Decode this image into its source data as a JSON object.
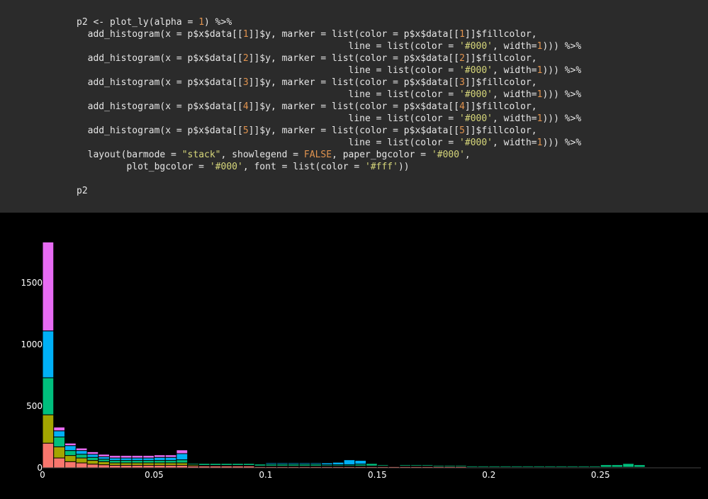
{
  "code": {
    "lines": [
      [
        {
          "t": "p2 <- plot_ly(alpha = "
        },
        {
          "t": "1",
          "c": "num"
        },
        {
          "t": ") %>%"
        }
      ],
      [
        {
          "t": "  add_histogram(x = p$x$data[["
        },
        {
          "t": "1",
          "c": "num"
        },
        {
          "t": "]]$y, marker = list(color = p$x$data[["
        },
        {
          "t": "1",
          "c": "num"
        },
        {
          "t": "]]$fillcolor,"
        }
      ],
      [
        {
          "t": "                                                 line = list(color = "
        },
        {
          "t": "'#000'",
          "c": "str"
        },
        {
          "t": ", width="
        },
        {
          "t": "1",
          "c": "num"
        },
        {
          "t": "))) %>%"
        }
      ],
      [
        {
          "t": "  add_histogram(x = p$x$data[["
        },
        {
          "t": "2",
          "c": "num"
        },
        {
          "t": "]]$y, marker = list(color = p$x$data[["
        },
        {
          "t": "2",
          "c": "num"
        },
        {
          "t": "]]$fillcolor,"
        }
      ],
      [
        {
          "t": "                                                 line = list(color = "
        },
        {
          "t": "'#000'",
          "c": "str"
        },
        {
          "t": ", width="
        },
        {
          "t": "1",
          "c": "num"
        },
        {
          "t": "))) %>%"
        }
      ],
      [
        {
          "t": "  add_histogram(x = p$x$data[["
        },
        {
          "t": "3",
          "c": "num"
        },
        {
          "t": "]]$y, marker = list(color = p$x$data[["
        },
        {
          "t": "3",
          "c": "num"
        },
        {
          "t": "]]$fillcolor,"
        }
      ],
      [
        {
          "t": "                                                 line = list(color = "
        },
        {
          "t": "'#000'",
          "c": "str"
        },
        {
          "t": ", width="
        },
        {
          "t": "1",
          "c": "num"
        },
        {
          "t": "))) %>%"
        }
      ],
      [
        {
          "t": "  add_histogram(x = p$x$data[["
        },
        {
          "t": "4",
          "c": "num"
        },
        {
          "t": "]]$y, marker = list(color = p$x$data[["
        },
        {
          "t": "4",
          "c": "num"
        },
        {
          "t": "]]$fillcolor,"
        }
      ],
      [
        {
          "t": "                                                 line = list(color = "
        },
        {
          "t": "'#000'",
          "c": "str"
        },
        {
          "t": ", width="
        },
        {
          "t": "1",
          "c": "num"
        },
        {
          "t": "))) %>%"
        }
      ],
      [
        {
          "t": "  add_histogram(x = p$x$data[["
        },
        {
          "t": "5",
          "c": "num"
        },
        {
          "t": "]]$y, marker = list(color = p$x$data[["
        },
        {
          "t": "5",
          "c": "num"
        },
        {
          "t": "]]$fillcolor,"
        }
      ],
      [
        {
          "t": "                                                 line = list(color = "
        },
        {
          "t": "'#000'",
          "c": "str"
        },
        {
          "t": ", width="
        },
        {
          "t": "1",
          "c": "num"
        },
        {
          "t": "))) %>%"
        }
      ],
      [
        {
          "t": "  layout(barmode = "
        },
        {
          "t": "\"stack\"",
          "c": "str"
        },
        {
          "t": ", showlegend = "
        },
        {
          "t": "FALSE",
          "c": "bool"
        },
        {
          "t": ", paper_bgcolor = "
        },
        {
          "t": "'#000'",
          "c": "str"
        },
        {
          "t": ","
        }
      ],
      [
        {
          "t": "         plot_bgcolor = "
        },
        {
          "t": "'#000'",
          "c": "str"
        },
        {
          "t": ", font = list(color = "
        },
        {
          "t": "'#fff'",
          "c": "str"
        },
        {
          "t": "))"
        }
      ],
      [
        {
          "t": ""
        }
      ],
      [
        {
          "t": "p2"
        }
      ]
    ]
  },
  "colors": {
    "code_bg": "#2b2b2b",
    "plot_bg": "#000000",
    "axis_text": "#ffffff",
    "bar_outline": "#000000"
  },
  "chart_data": {
    "type": "bar",
    "barmode": "stack",
    "showlegend": false,
    "grid": false,
    "bin_width": 0.005,
    "x_start": 0,
    "xlim": [
      0,
      0.295
    ],
    "ylim": [
      0,
      1850
    ],
    "x_ticks": [
      0,
      0.05,
      0.1,
      0.15,
      0.2,
      0.25
    ],
    "x_tick_labels": [
      "0",
      "0.05",
      "0.1",
      "0.15",
      "0.2",
      "0.25"
    ],
    "y_ticks": [
      0,
      500,
      1000,
      1500
    ],
    "y_tick_labels": [
      "0",
      "500",
      "1000",
      "1500"
    ],
    "series": [
      {
        "color": "#F8766D",
        "values": [
          200,
          80,
          50,
          40,
          30,
          25,
          20,
          20,
          20,
          20,
          20,
          20,
          20,
          15,
          15,
          15,
          15,
          15,
          15,
          10,
          10,
          10,
          10,
          10,
          10,
          10,
          10,
          10,
          10,
          10,
          10,
          10,
          10,
          10,
          10,
          10,
          10,
          10,
          5,
          5,
          5,
          5,
          5,
          5,
          5,
          5,
          5,
          5,
          5,
          5,
          5,
          5,
          5,
          5,
          5,
          5,
          5,
          5,
          5,
          5,
          5,
          5,
          5,
          5,
          5,
          5,
          5,
          5,
          5,
          5,
          15,
          15,
          15,
          35,
          10,
          5,
          5,
          5,
          5,
          5,
          5,
          5,
          5,
          5,
          5,
          5,
          5,
          5,
          15
        ]
      },
      {
        "color": "#A3A500",
        "values": [
          230,
          90,
          50,
          40,
          30,
          25,
          20,
          20,
          20,
          20,
          20,
          20,
          20,
          10,
          5,
          5,
          5,
          5,
          5,
          5,
          5,
          5,
          5,
          5,
          5,
          5,
          5,
          5,
          5,
          5,
          5,
          5,
          5,
          5,
          5,
          0,
          0,
          0,
          0,
          0,
          0,
          0,
          0,
          0,
          0,
          0,
          0,
          0,
          0,
          0,
          0,
          0,
          0,
          0,
          0,
          0,
          0,
          0,
          0,
          0,
          0,
          0,
          0,
          0,
          0,
          0,
          0,
          0,
          0,
          0,
          0,
          0,
          0,
          10,
          0,
          0,
          0,
          0,
          0,
          0,
          0,
          0,
          0,
          0,
          0,
          0,
          0,
          0,
          0
        ]
      },
      {
        "color": "#00BF7D",
        "values": [
          300,
          80,
          40,
          30,
          25,
          20,
          20,
          20,
          20,
          20,
          20,
          20,
          25,
          10,
          15,
          15,
          15,
          15,
          15,
          15,
          15,
          15,
          15,
          15,
          15,
          10,
          10,
          10,
          15,
          20,
          10,
          5,
          10,
          10,
          10,
          10,
          10,
          10,
          10,
          10,
          10,
          10,
          10,
          10,
          10,
          10,
          10,
          10,
          10,
          10,
          20,
          20,
          30,
          20,
          0,
          0,
          0,
          0,
          0,
          0,
          0,
          0,
          0,
          0,
          0,
          0,
          0,
          0,
          0,
          0,
          0,
          0,
          0,
          0,
          0,
          0,
          0,
          0,
          0,
          0,
          0,
          0,
          0,
          0,
          0,
          0,
          0,
          0,
          0
        ]
      },
      {
        "color": "#00B0F6",
        "values": [
          380,
          50,
          40,
          30,
          25,
          20,
          20,
          20,
          20,
          20,
          25,
          25,
          50,
          0,
          0,
          0,
          0,
          0,
          0,
          0,
          10,
          10,
          10,
          10,
          10,
          15,
          20,
          40,
          30,
          0,
          0,
          0,
          0,
          0,
          0,
          0,
          0,
          0,
          0,
          0,
          0,
          0,
          0,
          0,
          0,
          0,
          0,
          0,
          0,
          0,
          0,
          0,
          0,
          0,
          0,
          0,
          0,
          0,
          0,
          0,
          0,
          0,
          0,
          0,
          0,
          0,
          0,
          0,
          0,
          0,
          0,
          0,
          0,
          0,
          0,
          0,
          0,
          0,
          0,
          0,
          0,
          0,
          0,
          0,
          0,
          0,
          0,
          0,
          0
        ]
      },
      {
        "color": "#E76BF3",
        "values": [
          720,
          30,
          20,
          20,
          20,
          20,
          20,
          20,
          20,
          20,
          20,
          20,
          30,
          0,
          0,
          0,
          0,
          0,
          0,
          0,
          0,
          0,
          0,
          0,
          0,
          0,
          0,
          0,
          0,
          0,
          0,
          0,
          0,
          0,
          0,
          0,
          0,
          0,
          0,
          0,
          0,
          0,
          0,
          0,
          0,
          0,
          0,
          0,
          0,
          0,
          0,
          0,
          0,
          0,
          0,
          0,
          0,
          0,
          0,
          0,
          0,
          0,
          0,
          0,
          0,
          0,
          0,
          0,
          0,
          0,
          0,
          0,
          0,
          0,
          0,
          0,
          0,
          0,
          0,
          0,
          0,
          0,
          0,
          0,
          0,
          0,
          0,
          0,
          0
        ]
      }
    ]
  }
}
